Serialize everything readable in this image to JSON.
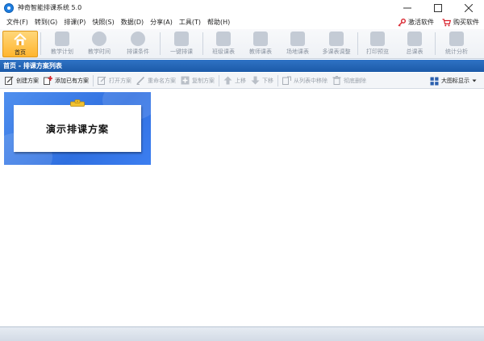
{
  "window": {
    "title": "神奇智能排课系统 5.0",
    "controls": [
      "minimize-icon",
      "maximize-icon",
      "close-icon"
    ]
  },
  "menu": {
    "items": [
      "文件(F)",
      "转到(G)",
      "排课(P)",
      "快照(S)",
      "数据(D)",
      "分享(A)",
      "工具(T)",
      "帮助(H)"
    ],
    "activate_label": "激活软件",
    "buy_label": "购买软件"
  },
  "ribbon": {
    "items": [
      {
        "label": "首页",
        "icon": "home-icon",
        "active": true
      },
      {
        "label": "教学计划",
        "icon": "plan-icon",
        "active": false
      },
      {
        "label": "教学时间",
        "icon": "clock-icon",
        "active": false
      },
      {
        "label": "排课条件",
        "icon": "conditions-icon",
        "active": false
      },
      {
        "label": "一键排课",
        "icon": "auto-schedule-icon",
        "active": false
      },
      {
        "label": "班级课表",
        "icon": "class-table-icon",
        "active": false
      },
      {
        "label": "教师课表",
        "icon": "teacher-table-icon",
        "active": false
      },
      {
        "label": "场地课表",
        "icon": "room-table-icon",
        "active": false
      },
      {
        "label": "多课表调整",
        "icon": "multi-table-icon",
        "active": false
      },
      {
        "label": "打印预览",
        "icon": "print-icon",
        "active": false
      },
      {
        "label": "总课表",
        "icon": "master-table-icon",
        "active": false
      },
      {
        "label": "统计分析",
        "icon": "stats-icon",
        "active": false
      }
    ]
  },
  "section": {
    "title": "首页 - 排课方案列表"
  },
  "toolbar": {
    "create": "创建方案",
    "add_existing": "添加已有方案",
    "open": "打开方案",
    "rename": "重命名方案",
    "copy": "复制方案",
    "move_up": "上移",
    "move_down": "下移",
    "remove": "从列表中移除",
    "delete": "彻底删除",
    "view_mode": "大图标显示"
  },
  "plans": [
    {
      "name": "演示排课方案"
    }
  ],
  "colors": {
    "accent": "#1c5aa8",
    "active_ribbon": "#ffb52e",
    "card_bg": "#2f6fe0"
  }
}
